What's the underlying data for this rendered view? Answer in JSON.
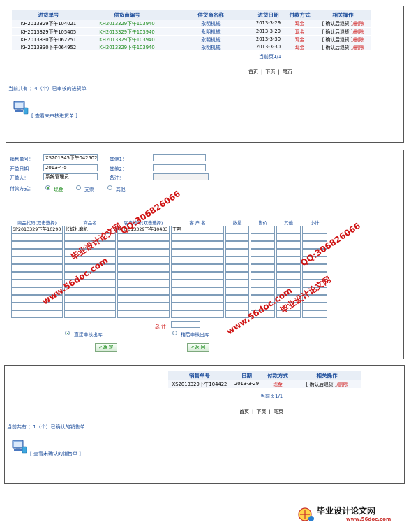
{
  "purchase_list": {
    "headers": [
      "进货单号",
      "供货商编号",
      "供货商名称",
      "进货日期",
      "付款方式",
      "相关操作"
    ],
    "rows": [
      {
        "id": "KH2013329下午104021",
        "supplier_no": "KH2013329下午103940",
        "supplier": "永明机械",
        "date": "2013-3-29",
        "payment": "现金",
        "confirm": "[ 确认后退货 ]",
        "delete": "/删除"
      },
      {
        "id": "KH2013329下午105405",
        "supplier_no": "KH2013329下午103940",
        "supplier": "永明机械",
        "date": "2013-3-29",
        "payment": "现金",
        "confirm": "[ 确认后退货 ]",
        "delete": "/删除"
      },
      {
        "id": "KH2013330下午062251",
        "supplier_no": "KH2013329下午103940",
        "supplier": "永明机械",
        "date": "2013-3-30",
        "payment": "现金",
        "confirm": "[ 确认后退货 ]",
        "delete": "/删除"
      },
      {
        "id": "KH2013330下午064952",
        "supplier_no": "KH2013329下午103940",
        "supplier": "永明机械",
        "date": "2013-3-30",
        "payment": "现金",
        "confirm": "[ 确认后退货 ]",
        "delete": "/删除"
      }
    ],
    "page_indicator": "当前页1/1",
    "nav": {
      "first": "首页",
      "prev": "下页",
      "last": "尾页",
      "sep1": "|",
      "sep2": "|"
    },
    "summary": "当前共有 ：4（个）已审核的进货单",
    "link": "[ 查看未审核进货单 ]"
  },
  "sales_form": {
    "fields": {
      "order_no_label": "销售单号：",
      "order_no_value": "XS201345下午042502",
      "date_label": "开单日期",
      "date_value": "2013-4-5",
      "creator_label": "开单人：",
      "creator_value": "系统管理员",
      "payment_label": "付款方式：",
      "other1_label": "其他1：",
      "other2_label": "其他2：",
      "remark_label": "备注："
    },
    "payment_options": [
      {
        "label": "现金",
        "selected": true
      },
      {
        "label": "支票",
        "selected": false
      },
      {
        "label": "其他",
        "selected": false
      }
    ],
    "grid_headers": [
      "商品代码(双击选择)",
      "商品名",
      "客户编号(双击选择)",
      "客 户 名",
      "数量",
      "售价",
      "其他",
      "小计"
    ],
    "first_row": {
      "code": "SP2013329下午10290",
      "name": "长城扎磨机",
      "client_no": "KH2013329下午10433",
      "client_name": "王明"
    },
    "total_label": "总 计：",
    "outbound_options": [
      {
        "label": "直接审核出库",
        "selected": true
      },
      {
        "label": "稍后审核出库",
        "selected": false
      }
    ],
    "confirm_label": "确 定",
    "back_label": "返 回"
  },
  "sales_list": {
    "headers": [
      "销售单号",
      "日期",
      "付款方式",
      "相关操作"
    ],
    "row": {
      "id": "XS2013329下午104422",
      "date": "2013-3-29",
      "payment": "现金",
      "confirm": "[ 确认后退货 ]",
      "delete": "/删除"
    },
    "page_indicator": "当前页1/1",
    "nav": {
      "first": "首页",
      "prev": "下页",
      "last": "尾页",
      "sep1": "|",
      "sep2": "|"
    },
    "summary": "当前共有 ：1（个）已确认的销售单",
    "link": "[ 查看未确认的销售单 ]"
  },
  "watermarks": {
    "site": "www.56doc.com",
    "qq": "QQ:306826066",
    "brand": "毕业设计论文网"
  },
  "bottom_logo": {
    "title": "毕业设计论文网",
    "url": "www.56doc.com"
  },
  "colors": {
    "header_blue": "#1a4b9a",
    "green": "#1a8a1a",
    "red": "#d01818",
    "header_bg": "#e8eef6"
  }
}
